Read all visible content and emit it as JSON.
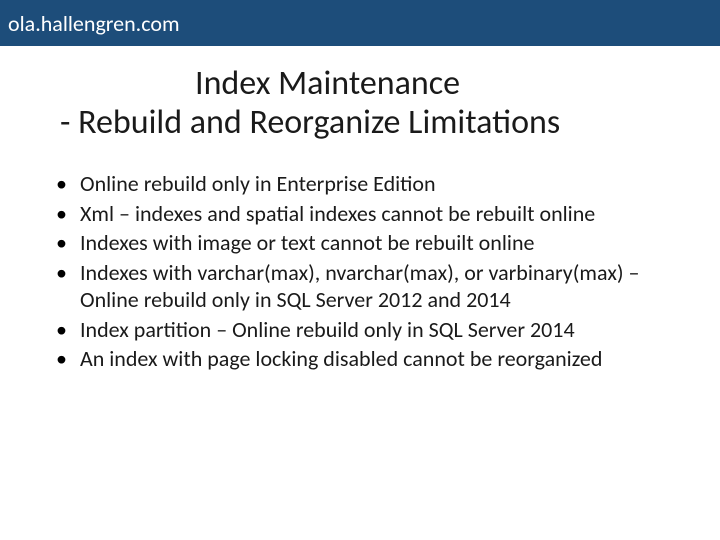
{
  "header": {
    "site": "ola.hallengren.com"
  },
  "slide": {
    "title_line1": "Index Maintenance",
    "title_line2": "- Rebuild and Reorganize Limitations",
    "bullets": [
      "Online rebuild only in Enterprise Edition",
      "Xml – indexes and spatial indexes cannot be rebuilt online",
      "Indexes with image or text cannot be rebuilt online",
      "Indexes with varchar(max), nvarchar(max), or varbinary(max) – Online rebuild only in SQL Server 2012 and 2014",
      "Index partition – Online rebuild only in SQL Server 2014",
      "An index with page locking disabled cannot be reorganized"
    ]
  }
}
